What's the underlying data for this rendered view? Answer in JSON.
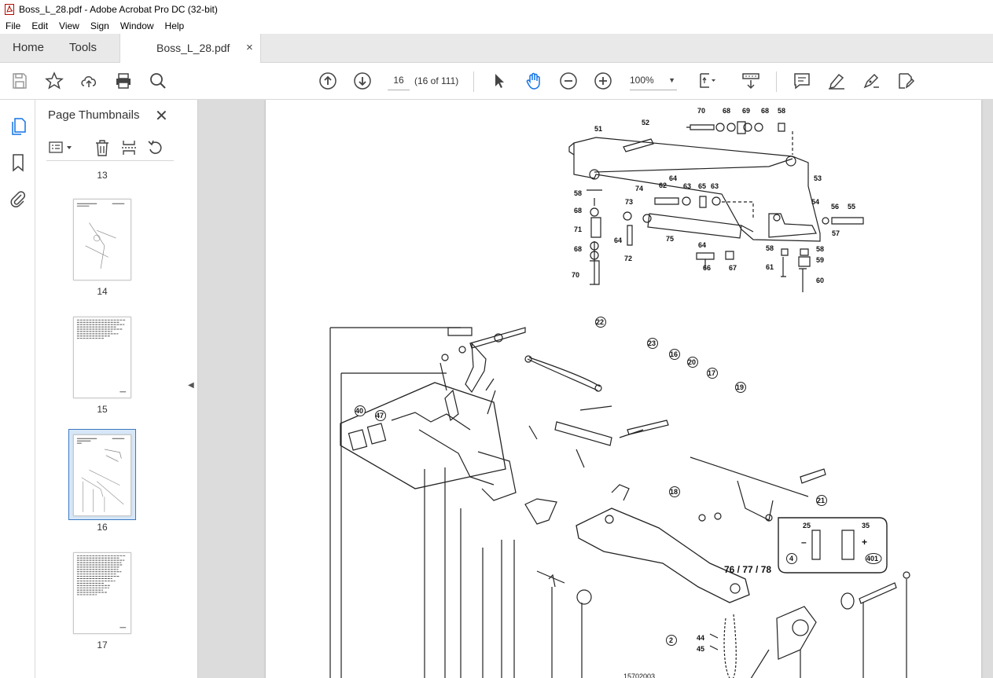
{
  "window": {
    "title": "Boss_L_28.pdf - Adobe Acrobat Pro DC (32-bit)"
  },
  "menu": [
    "File",
    "Edit",
    "View",
    "Sign",
    "Window",
    "Help"
  ],
  "nav_tabs": {
    "home": "Home",
    "tools": "Tools"
  },
  "doc_tab": {
    "title": "Boss_L_28.pdf",
    "close": "×"
  },
  "toolbar": {
    "page_current": "16",
    "page_count": "(16 of 111)",
    "zoom": "100%"
  },
  "panel": {
    "title": "Page Thumbnails",
    "close": "✕",
    "thumbnails": [
      {
        "label": "13"
      },
      {
        "label": "14"
      },
      {
        "label": "15"
      },
      {
        "label": "16",
        "selected": true
      },
      {
        "label": "17"
      }
    ]
  },
  "drawing": {
    "upper_labels": [
      "51",
      "52",
      "70",
      "68",
      "69",
      "68",
      "58",
      "53",
      "74",
      "62",
      "64",
      "63",
      "65",
      "63",
      "58",
      "68",
      "71",
      "68",
      "70",
      "73",
      "64",
      "72",
      "75",
      "54",
      "56",
      "55",
      "57",
      "64",
      "66",
      "67",
      "58",
      "58",
      "59",
      "61",
      "60"
    ],
    "lower_labels": [
      "22",
      "23",
      "16",
      "20",
      "17",
      "19",
      "40",
      "47",
      "18",
      "21",
      "76 / 77 / 78",
      "2",
      "44",
      "45"
    ],
    "inset": {
      "left_value": "25",
      "right_value": "35",
      "minus": "–",
      "plus": "+",
      "left_ref": "4",
      "right_ref": "401"
    },
    "bottom_code": "15702003"
  }
}
